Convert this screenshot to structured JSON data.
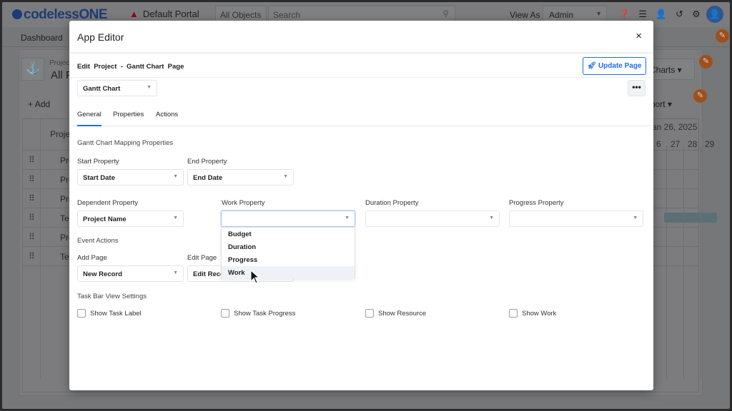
{
  "background": {
    "logo": "codelessONE",
    "portal": "Default Portal",
    "object_select": "All Objects",
    "search_placeholder": "Search",
    "view_as_label": "View As :",
    "view_as_value": "Admin",
    "nav_item": "Dashboard",
    "project_small": "Project",
    "project_big": "All P",
    "charts_button": "Charts",
    "add_button": "Add",
    "export_button": "Export",
    "grid_header": "Projec",
    "date_header": "an 26, 2025",
    "days": [
      "6",
      "27",
      "28",
      "29"
    ],
    "rows": [
      "Pro",
      "Pro",
      "Pro",
      "Tes",
      "Pro",
      "Tes"
    ],
    "bar_color": "#5e7479"
  },
  "modal": {
    "title": "App Editor",
    "close": "×",
    "breadcrumb": "Edit  Project  -  Gantt Chart  Page",
    "update_button": "Update Page",
    "view_select": "Gantt Chart",
    "more": "•••",
    "tabs": [
      {
        "label": "General"
      },
      {
        "label": "Properties"
      },
      {
        "label": "Actions"
      }
    ],
    "mapping_title": "Gantt Chart Mapping Properties",
    "start_label": "Start Property",
    "start_value": "Start Date",
    "end_label": "End Property",
    "end_value": "End Date",
    "dependent_label": "Dependent Property",
    "dependent_value": "Project Name",
    "work_label": "Work Property",
    "work_value": "",
    "duration_label": "Duration Property",
    "duration_value": "",
    "progress_label": "Progress Property",
    "progress_value": "",
    "work_options": [
      "Budget",
      "Duration",
      "Progress",
      "Work"
    ],
    "event_title": "Event Actions",
    "add_page_label": "Add Page",
    "add_page_value": "New Record",
    "edit_page_label": "Edit Page",
    "edit_page_value": "Edit Recor",
    "taskbar_title": "Task Bar View Settings",
    "checkboxes": [
      "Show Task Label",
      "Show Task Progress",
      "Show Resource",
      "Show Work"
    ],
    "accent_color": "#1e6ee8"
  }
}
